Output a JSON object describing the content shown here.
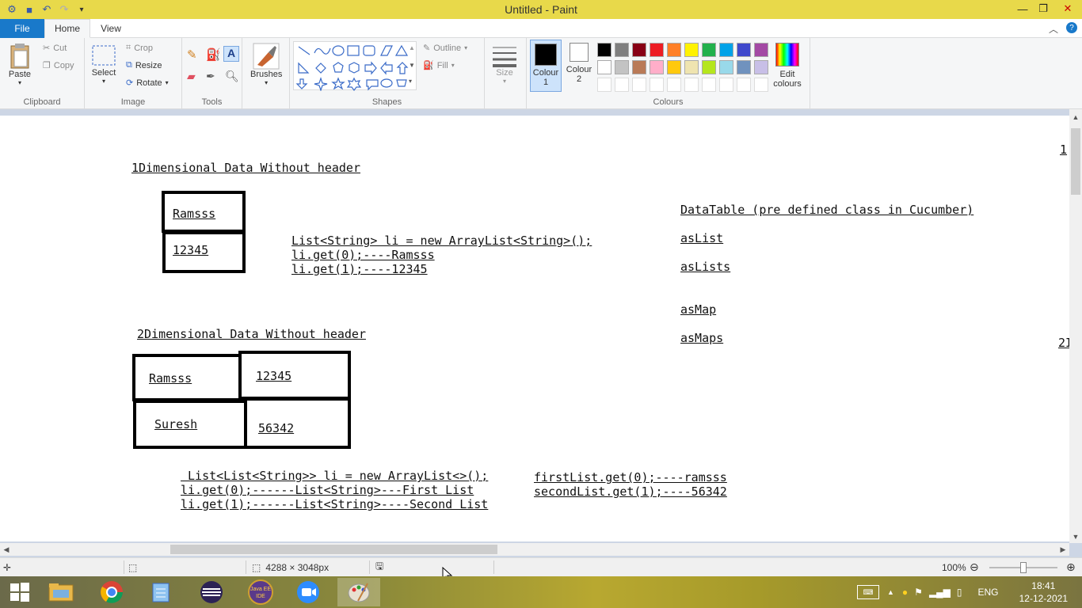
{
  "window": {
    "title": "Untitled - Paint"
  },
  "ribbon": {
    "tabs": [
      "File",
      "Home",
      "View"
    ],
    "clipboard": {
      "paste": "Paste",
      "cut": "Cut",
      "copy": "Copy",
      "label": "Clipboard"
    },
    "image": {
      "select": "Select",
      "crop": "Crop",
      "resize": "Resize",
      "rotate": "Rotate",
      "label": "Image"
    },
    "tools": {
      "label": "Tools"
    },
    "brushes": {
      "label": "Brushes"
    },
    "shapes": {
      "outline": "Outline",
      "fill": "Fill",
      "label": "Shapes"
    },
    "size": {
      "label": "Size"
    },
    "colours": {
      "colour1": "Colour 1",
      "colour2": "Colour 2",
      "edit": "Edit colours",
      "label": "Colours",
      "palette_row1": [
        "#000000",
        "#7f7f7f",
        "#880015",
        "#ed1c24",
        "#ff7f27",
        "#fff200",
        "#22b14c",
        "#00a2e8",
        "#3f48cc",
        "#a349a4"
      ],
      "palette_row2": [
        "#ffffff",
        "#c3c3c3",
        "#b97a57",
        "#ffaec9",
        "#ffc90e",
        "#efe4b0",
        "#b5e61d",
        "#99d9ea",
        "#7092be",
        "#c8bfe7"
      ]
    }
  },
  "canvas": {
    "heading1": "1Dimensional Data Without header",
    "box1_a": "Ramsss",
    "box1_b": "12345",
    "code1_l1": "List<String> li = new ArrayList<String>();",
    "code1_l2": "li.get(0);----Ramsss",
    "code1_l3": "li.get(1);----12345",
    "datatable": "DataTable (pre defined class in Cucumber)",
    "aslist": "asList",
    "aslists": "asLists",
    "asmap": "asMap",
    "asmaps": "asMaps",
    "edge1": "1",
    "edge2": "2I",
    "heading2": "2Dimensional Data Without header",
    "grid_r1c1": "Ramsss",
    "grid_r1c2": "12345",
    "grid_r2c1": "Suresh",
    "grid_r2c2": "56342",
    "code2_l1": " List<List<String>> li = new ArrayList<>();",
    "code2_l2": "li.get(0);------List<String>---First List",
    "code2_l3": "li.get(1);------List<String>----Second List",
    "code3_l1": "firstList.get(0);----ramsss",
    "code3_l2": "secondList.get(1);----56342"
  },
  "status": {
    "dimensions": "4288 × 3048px",
    "zoom": "100%"
  },
  "taskbar": {
    "language": "ENG",
    "time": "18:41",
    "date": "12-12-2021"
  }
}
